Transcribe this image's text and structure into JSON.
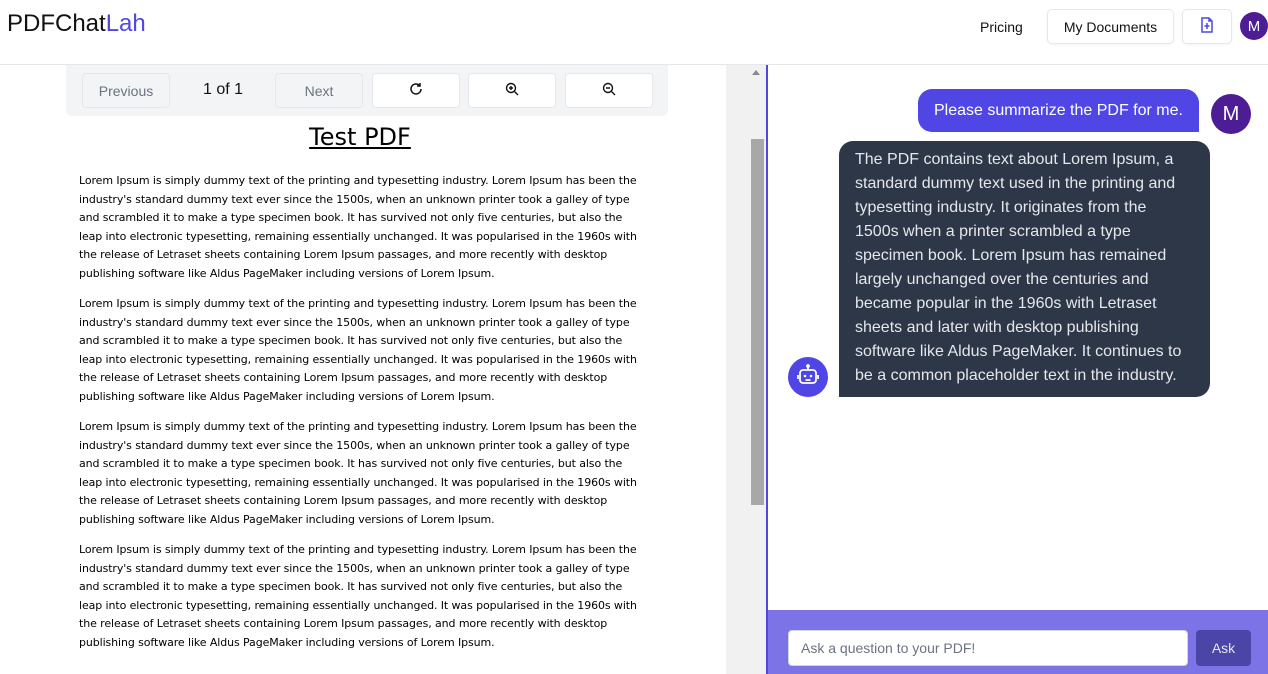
{
  "header": {
    "logo_part1": "PDFChat",
    "logo_part2": "Lah",
    "pricing": "Pricing",
    "my_documents": "My Documents",
    "avatar": "M"
  },
  "viewer": {
    "previous": "Previous",
    "page_indicator": "1 of 1",
    "next": "Next",
    "title": "Test PDF",
    "paragraphs": [
      "Lorem Ipsum is simply dummy text of the printing and typesetting industry. Lorem Ipsum has been the industry's standard dummy text ever since the 1500s, when an unknown printer took a galley of type and scrambled it to make a type specimen book. It has survived not only five centuries, but also the leap into electronic typesetting, remaining essentially unchanged. It was popularised in the 1960s with the release of Letraset sheets containing Lorem Ipsum passages, and more recently with desktop publishing software like Aldus PageMaker including versions of Lorem Ipsum.",
      "Lorem Ipsum is simply dummy text of the printing and typesetting industry. Lorem Ipsum has been the industry's standard dummy text ever since the 1500s, when an unknown printer took a galley of type and scrambled it to make a type specimen book. It has survived not only five centuries, but also the leap into electronic typesetting, remaining essentially unchanged. It was popularised in the 1960s with the release of Letraset sheets containing Lorem Ipsum passages, and more recently with desktop publishing software like Aldus PageMaker including versions of Lorem Ipsum.",
      "Lorem Ipsum is simply dummy text of the printing and typesetting industry. Lorem Ipsum has been the industry's standard dummy text ever since the 1500s, when an unknown printer took a galley of type and scrambled it to make a type specimen book. It has survived not only five centuries, but also the leap into electronic typesetting, remaining essentially unchanged. It was popularised in the 1960s with the release of Letraset sheets containing Lorem Ipsum passages, and more recently with desktop publishing software like Aldus PageMaker including versions of Lorem Ipsum.",
      "Lorem Ipsum is simply dummy text of the printing and typesetting industry. Lorem Ipsum has been the industry's standard dummy text ever since the 1500s, when an unknown printer took a galley of type and scrambled it to make a type specimen book. It has survived not only five centuries, but also the leap into electronic typesetting, remaining essentially unchanged. It was popularised in the 1960s with the release of Letraset sheets containing Lorem Ipsum passages, and more recently with desktop publishing software like Aldus PageMaker including versions of Lorem Ipsum."
    ]
  },
  "chat": {
    "user_avatar": "M",
    "messages": [
      {
        "role": "user",
        "text": "Please summarize the PDF for me."
      },
      {
        "role": "bot",
        "text": "The PDF contains text about Lorem Ipsum, a standard dummy text used in the printing and typesetting industry. It originates from the 1500s when a printer scrambled a type specimen book. Lorem Ipsum has remained largely unchanged over the centuries and became popular in the 1960s with Letraset sheets and later with desktop publishing software like Aldus PageMaker. It continues to be a common placeholder text in the industry."
      }
    ],
    "input_placeholder": "Ask a question to your PDF!",
    "ask_label": "Ask"
  },
  "colors": {
    "accent": "#4f46e5",
    "avatar": "#4c1d95",
    "bot_bubble": "#2d3748",
    "input_bar": "#7c73e6"
  },
  "icons": [
    "upload-file-icon",
    "refresh-icon",
    "zoom-in-icon",
    "zoom-out-icon",
    "robot-icon"
  ]
}
